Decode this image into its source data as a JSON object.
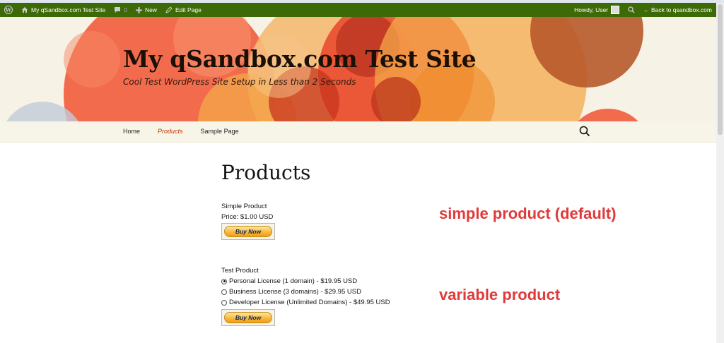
{
  "admin_bar": {
    "site_name": "My qSandbox.com Test Site",
    "comments_count": "0",
    "new_label": "New",
    "edit_label": "Edit Page",
    "howdy": "Howdy, User",
    "back_link": "← Back to qsandbox.com"
  },
  "header": {
    "title": "My qSandbox.com Test Site",
    "description": "Cool Test WordPress Site Setup in Less than 2 Seconds"
  },
  "nav": {
    "items": [
      {
        "label": "Home"
      },
      {
        "label": "Products"
      },
      {
        "label": "Sample Page"
      }
    ]
  },
  "page": {
    "title": "Products",
    "simple_product": {
      "name": "Simple Product",
      "price": "Price: $1.00 USD",
      "button_label": "Buy Now"
    },
    "test_product": {
      "name": "Test Product",
      "options": [
        {
          "label": "Personal License (1 domain) - $19.95 USD",
          "selected": true
        },
        {
          "label": "Business License (3 domains) - $29.95 USD",
          "selected": false
        },
        {
          "label": "Developer License (Unlimited Domains) - $49.95 USD",
          "selected": false
        }
      ],
      "button_label": "Buy Now"
    }
  },
  "annotations": {
    "simple": "simple product (default)",
    "variable": "variable product"
  },
  "colors": {
    "admin_bar": "#3c6a07",
    "accent": "#bc360a",
    "annotation": "#e03a3a"
  }
}
